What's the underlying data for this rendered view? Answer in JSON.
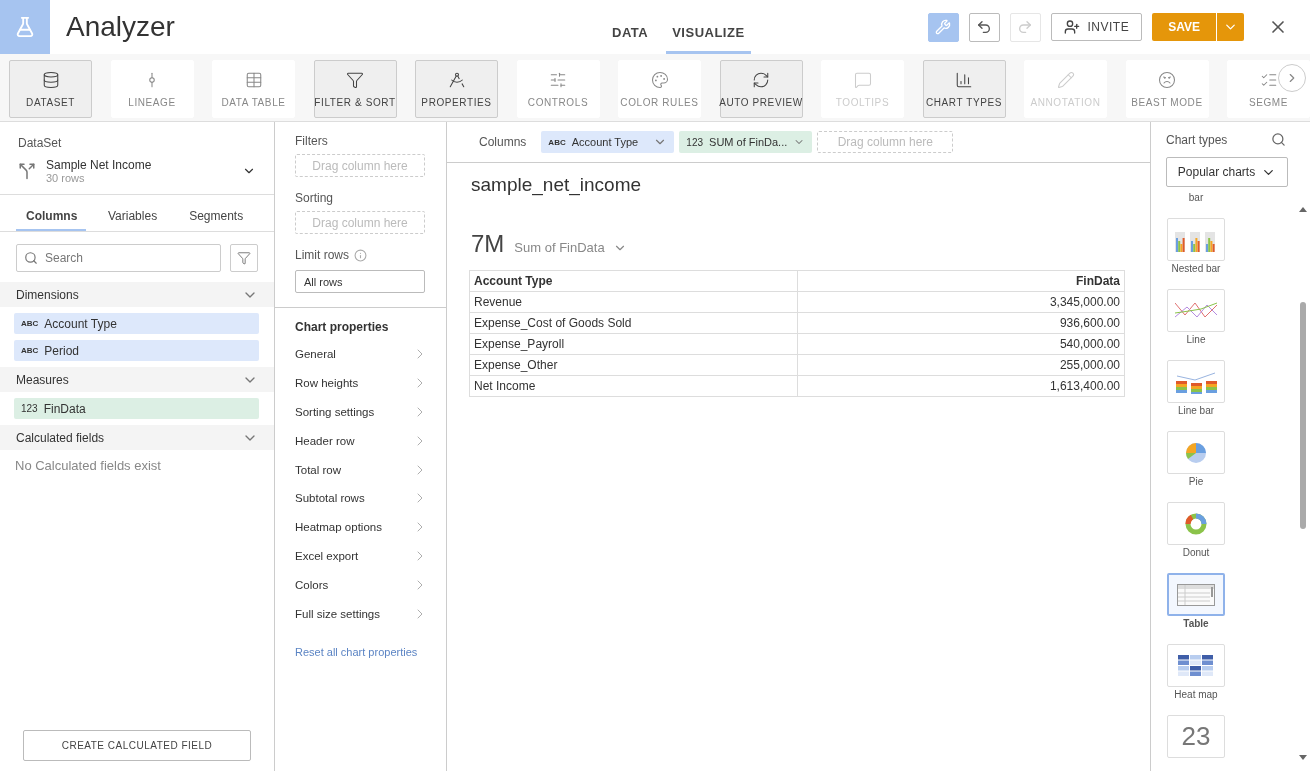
{
  "app": {
    "title": "Analyzer"
  },
  "nav_tabs": [
    {
      "label": "DATA",
      "selected": false
    },
    {
      "label": "VISUALIZE",
      "selected": true
    }
  ],
  "header_actions": {
    "tools_active": true,
    "undo_disabled": false,
    "redo_disabled": true,
    "invite": "INVITE",
    "save": "SAVE"
  },
  "toolbar": [
    {
      "label": "DATASET",
      "selected": true,
      "disabled": false
    },
    {
      "label": "LINEAGE",
      "selected": false,
      "disabled": false
    },
    {
      "label": "DATA TABLE",
      "selected": false,
      "disabled": false
    },
    {
      "label": "FILTER & SORT",
      "selected": true,
      "disabled": false
    },
    {
      "label": "PROPERTIES",
      "selected": true,
      "disabled": false
    },
    {
      "label": "CONTROLS",
      "selected": false,
      "disabled": false
    },
    {
      "label": "COLOR RULES",
      "selected": false,
      "disabled": false
    },
    {
      "label": "AUTO PREVIEW",
      "selected": true,
      "disabled": false
    },
    {
      "label": "TOOLTIPS",
      "selected": false,
      "disabled": true
    },
    {
      "label": "CHART TYPES",
      "selected": true,
      "disabled": false
    },
    {
      "label": "ANNOTATION",
      "selected": false,
      "disabled": true
    },
    {
      "label": "BEAST MODE",
      "selected": false,
      "disabled": false
    },
    {
      "label": "SEGME",
      "selected": false,
      "disabled": false
    }
  ],
  "dataset_panel": {
    "heading": "DataSet",
    "name": "Sample Net Income",
    "rows": "30 rows",
    "tabs": [
      {
        "label": "Columns",
        "selected": true
      },
      {
        "label": "Variables",
        "selected": false
      },
      {
        "label": "Segments",
        "selected": false
      }
    ],
    "search": {
      "placeholder": "Search"
    },
    "sections": [
      {
        "title": "Dimensions",
        "expanded": true,
        "kind": "dimension",
        "items": [
          {
            "type_label": "ABC",
            "label": "Account Type"
          },
          {
            "type_label": "ABC",
            "label": "Period"
          }
        ]
      },
      {
        "title": "Measures",
        "expanded": true,
        "kind": "measure",
        "items": [
          {
            "type_label": "123",
            "label": "FinData"
          }
        ]
      },
      {
        "title": "Calculated fields",
        "expanded": true,
        "kind": "calculated",
        "empty_text": "No Calculated fields exist"
      }
    ],
    "create_button": "CREATE CALCULATED FIELD"
  },
  "properties_panel": {
    "filters": {
      "label": "Filters",
      "drop_hint": "Drag column here"
    },
    "sorting": {
      "label": "Sorting",
      "drop_hint": "Drag column here"
    },
    "limit_rows": {
      "label": "Limit rows",
      "value": "All rows"
    },
    "chart_properties": {
      "heading": "Chart properties",
      "items": [
        "General",
        "Row heights",
        "Sorting settings",
        "Header row",
        "Total row",
        "Subtotal rows",
        "Heatmap options",
        "Excel export",
        "Colors",
        "Full size settings"
      ],
      "reset_link": "Reset all chart properties"
    }
  },
  "columns_bar": {
    "label": "Columns",
    "pills": [
      {
        "kind": "dimension",
        "type_label": "ABC",
        "label": "Account Type"
      },
      {
        "kind": "measure",
        "type_label": "123",
        "label": "SUM of FinDa..."
      }
    ],
    "drop_hint": "Drag column here"
  },
  "chart": {
    "title": "sample_net_income",
    "summary_value": "7M",
    "summary_label": "Sum of FinData",
    "table": {
      "columns": [
        "Account Type",
        "FinData"
      ],
      "rows": [
        [
          "Revenue",
          "3,345,000.00"
        ],
        [
          "Expense_Cost of Goods Sold",
          "936,600.00"
        ],
        [
          "Expense_Payroll",
          "540,000.00"
        ],
        [
          "Expense_Other",
          "255,000.00"
        ],
        [
          "Net Income",
          "1,613,400.00"
        ]
      ]
    }
  },
  "chart_types": {
    "heading": "Chart types",
    "filter": "Popular charts",
    "items": [
      {
        "kind": "label_only",
        "label": "bar",
        "selected": false
      },
      {
        "kind": "nested_bar",
        "label": "Nested bar",
        "selected": false
      },
      {
        "kind": "line",
        "label": "Line",
        "selected": false
      },
      {
        "kind": "line_bar",
        "label": "Line bar",
        "selected": false
      },
      {
        "kind": "pie",
        "label": "Pie",
        "selected": false
      },
      {
        "kind": "donut",
        "label": "Donut",
        "selected": false
      },
      {
        "kind": "table",
        "label": "Table",
        "selected": true
      },
      {
        "kind": "heat_map",
        "label": "Heat map",
        "selected": false
      },
      {
        "kind": "number",
        "preview_text": "23",
        "selected": false
      }
    ]
  }
}
